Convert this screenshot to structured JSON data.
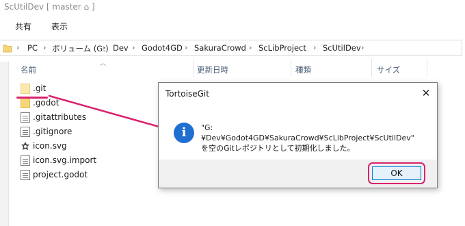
{
  "window": {
    "title": "ScUtilDev [ master ⌂ ]"
  },
  "ribbon": {
    "tabs": [
      "共有",
      "表示"
    ]
  },
  "address": {
    "crumbs": [
      "PC",
      "ボリューム (G:)",
      "Dev",
      "Godot4GD",
      "SakuraCrowd",
      "ScLibProject",
      "ScUtilDev"
    ]
  },
  "columns": {
    "name": "名前",
    "modified": "更新日時",
    "type": "種類",
    "size": "サイズ"
  },
  "files": [
    {
      "name": ".git",
      "icon": "folder-icon"
    },
    {
      "name": ".godot",
      "icon": "folder-icon"
    },
    {
      "name": ".gitattributes",
      "icon": "file-icon"
    },
    {
      "name": ".gitignore",
      "icon": "file-icon"
    },
    {
      "name": "icon.svg",
      "icon": "svg-icon"
    },
    {
      "name": "icon.svg.import",
      "icon": "file-icon"
    },
    {
      "name": "project.godot",
      "icon": "file-icon"
    }
  ],
  "dialog": {
    "title": "TortoiseGit",
    "message": "\"G:¥Dev¥Godot4GD¥SakuraCrowd¥ScLibProject¥ScUtilDev\" を空のGitレポジトリとして初期化しました。",
    "ok_label": "OK",
    "close_glyph": "✕",
    "info_glyph": "i"
  },
  "colors": {
    "annotation": "#d8236d",
    "accent": "#0078d7",
    "info": "#1f6fd1"
  }
}
